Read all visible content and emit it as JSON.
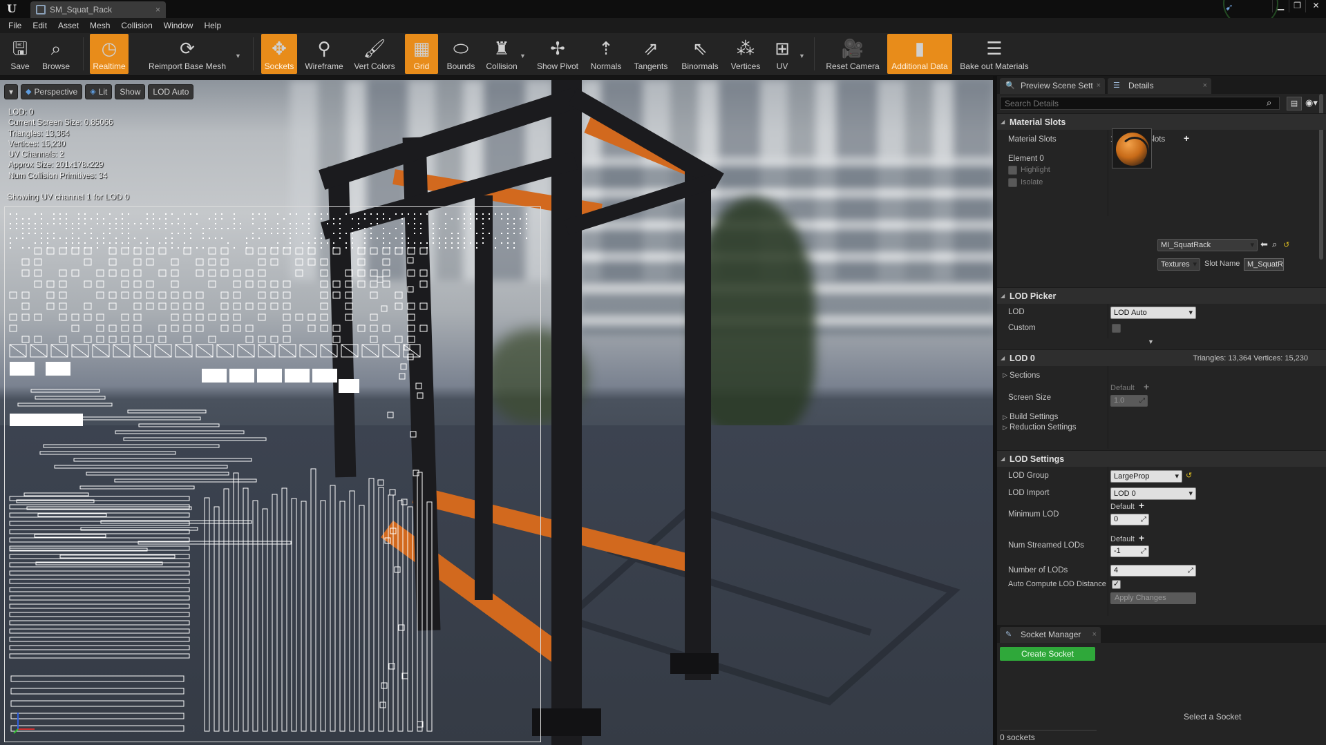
{
  "window": {
    "tab_title": "SM_Squat_Rack",
    "controls": {
      "minimize": "▁",
      "restore": "❐",
      "close": "✕"
    }
  },
  "menu": [
    "File",
    "Edit",
    "Asset",
    "Mesh",
    "Collision",
    "Window",
    "Help"
  ],
  "toolbar": {
    "save": "Save",
    "browse": "Browse",
    "realtime": "Realtime",
    "reimport": "Reimport Base Mesh",
    "sockets": "Sockets",
    "wireframe": "Wireframe",
    "vert_colors": "Vert Colors",
    "grid": "Grid",
    "bounds": "Bounds",
    "collision": "Collision",
    "show_pivot": "Show Pivot",
    "normals": "Normals",
    "tangents": "Tangents",
    "binormals": "Binormals",
    "vertices": "Vertices",
    "uv": "UV",
    "reset_camera": "Reset Camera",
    "additional_data": "Additional Data",
    "bake_out": "Bake out Materials",
    "accent": "#e88c1a"
  },
  "viewport": {
    "perspective": "Perspective",
    "lit": "Lit",
    "show": "Show",
    "lod_auto": "LOD Auto",
    "stats": [
      "LOD:  0",
      "Current Screen Size:  0.85066",
      "Triangles:  13,364",
      "Vertices:  15,230",
      "UV Channels:  2",
      "Approx Size: 201x178x229",
      "Num Collision Primitives:  34"
    ],
    "uv_caption": "Showing UV channel 1 for LOD 0",
    "frame_color": "#1b1b1e",
    "bar_color": "#d2691e"
  },
  "panel": {
    "tab_preview": "Preview Scene Sett",
    "tab_details": "Details",
    "search_placeholder": "Search Details",
    "material_slots": {
      "header": "Material Slots",
      "label": "Material Slots",
      "count": "1 Material Slots",
      "element": "Element 0",
      "highlight": "Highlight",
      "isolate": "Isolate",
      "material": "MI_SquatRack",
      "textures": "Textures",
      "slot_name_label": "Slot Name",
      "slot_name": "M_SquatR"
    },
    "lod_picker": {
      "header": "LOD Picker",
      "lod_label": "LOD",
      "lod_value": "LOD Auto",
      "custom": "Custom"
    },
    "lod0": {
      "header": "LOD 0",
      "stats": "Triangles: 13,364   Vertices: 15,230",
      "sections": "Sections",
      "screen_size": "Screen Size",
      "default": "Default",
      "screen_size_value": "1.0",
      "build_settings": "Build Settings",
      "reduction_settings": "Reduction Settings"
    },
    "lod_settings": {
      "header": "LOD Settings",
      "lod_group": "LOD Group",
      "lod_group_value": "LargeProp",
      "lod_import": "LOD Import",
      "lod_import_value": "LOD 0",
      "min_lod": "Minimum LOD",
      "min_lod_default": "Default",
      "min_lod_value": "0",
      "num_streamed": "Num Streamed LODs",
      "num_streamed_default": "Default",
      "num_streamed_value": "-1",
      "num_lods": "Number of LODs",
      "num_lods_value": "4",
      "auto_compute": "Auto Compute LOD Distance",
      "apply": "Apply Changes"
    },
    "socket_manager": {
      "tab": "Socket Manager",
      "create": "Create Socket",
      "select_hint": "Select a Socket",
      "count": "0 sockets"
    }
  }
}
